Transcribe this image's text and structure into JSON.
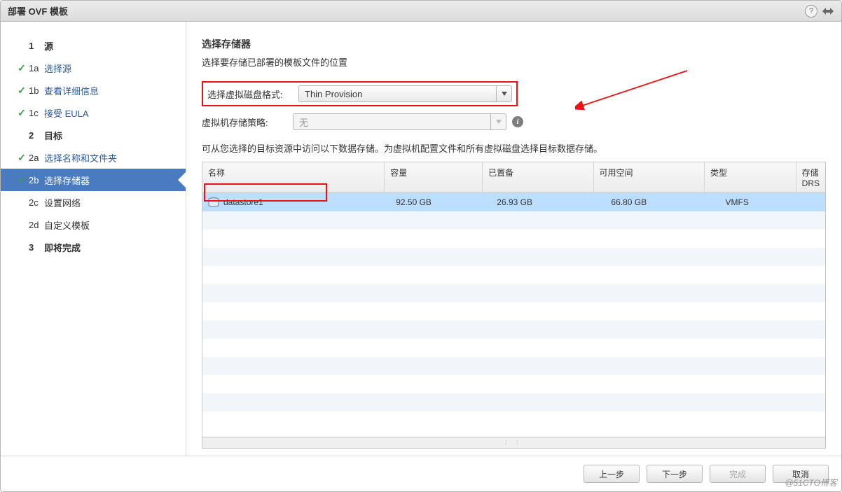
{
  "titlebar": {
    "title": "部署 OVF 模板"
  },
  "sidebar": {
    "steps": [
      {
        "num": "1",
        "label": "源",
        "group": true
      },
      {
        "num": "1a",
        "label": "选择源",
        "done": true
      },
      {
        "num": "1b",
        "label": "查看详细信息",
        "done": true
      },
      {
        "num": "1c",
        "label": "接受 EULA",
        "done": true
      },
      {
        "num": "2",
        "label": "目标",
        "group": true
      },
      {
        "num": "2a",
        "label": "选择名称和文件夹",
        "done": true
      },
      {
        "num": "2b",
        "label": "选择存储器",
        "done": true,
        "selected": true
      },
      {
        "num": "2c",
        "label": "设置网络",
        "inactive": true
      },
      {
        "num": "2d",
        "label": "自定义模板",
        "inactive": true
      },
      {
        "num": "3",
        "label": "即将完成",
        "group": true
      }
    ]
  },
  "main": {
    "title": "选择存储器",
    "subtitle": "选择要存储已部署的模板文件的位置",
    "disk_format_label": "选择虚拟磁盘格式:",
    "disk_format_value": "Thin Provision",
    "policy_label": "虚拟机存储策略:",
    "policy_value": "无",
    "hint": "可从您选择的目标资源中访问以下数据存储。为虚拟机配置文件和所有虚拟磁盘选择目标数据存储。",
    "columns": {
      "name": "名称",
      "capacity": "容量",
      "provisioned": "已置备",
      "free": "可用空间",
      "type": "类型",
      "drs": "存储 DRS"
    },
    "rows": [
      {
        "name": "datastore1",
        "capacity": "92.50 GB",
        "provisioned": "26.93 GB",
        "free": "66.80 GB",
        "type": "VMFS",
        "drs": ""
      }
    ]
  },
  "footer": {
    "back": "上一步",
    "next": "下一步",
    "finish": "完成",
    "cancel": "取消"
  },
  "watermark": "@51CTO博客"
}
